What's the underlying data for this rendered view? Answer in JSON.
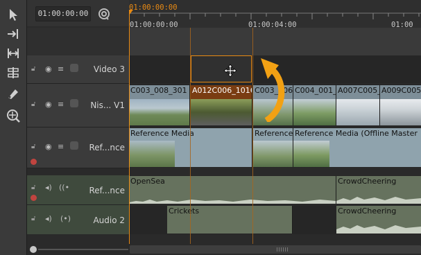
{
  "toolbar": {
    "tools": [
      "select-arrow-icon",
      "ripple-insert-icon",
      "slip-icon",
      "slide-icon",
      "razor-icon",
      "magnifier-icon"
    ]
  },
  "timecode": "01:00:00:00",
  "ruler": {
    "playhead_tc": "01:00:00:00",
    "tick_labels": [
      "01:00:00:00",
      "01:00:04:00",
      "01:00"
    ]
  },
  "tracks": [
    {
      "name": "Video 3",
      "type": "video"
    },
    {
      "name": "Nis... V1",
      "type": "video"
    },
    {
      "name": "Ref...nce",
      "type": "video"
    },
    {
      "name": "Ref...nce",
      "type": "audio"
    },
    {
      "name": "Audio 2",
      "type": "audio"
    }
  ],
  "clips": {
    "v1": [
      "C003_008_301",
      "A012C006_1016",
      "C003_006",
      "C004_001_",
      "A007C005_",
      "A009C005_"
    ],
    "ref": [
      "Reference Media",
      "Reference",
      "Reference Media (Offline Master"
    ],
    "a1": [
      "OpenSea",
      "CrowdCheering"
    ],
    "a2": [
      "Crickets",
      "CrowdCheering"
    ]
  },
  "colors": {
    "playhead": "#e98a12",
    "selection": "#e98a12",
    "accent_arrow": "#f2a114"
  }
}
